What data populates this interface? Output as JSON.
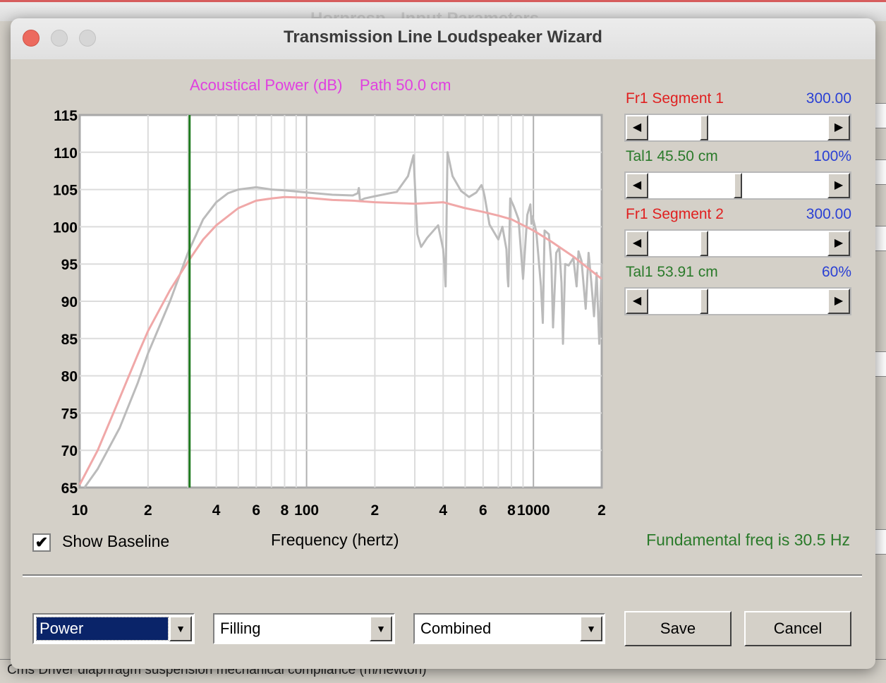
{
  "parent": {
    "title": "Hornresp - Input Parameters",
    "status": "Cms   Driver diaphragm suspension mechanical compliance  (m/newton)"
  },
  "dialog": {
    "title": "Transmission Line Loudspeaker Wizard"
  },
  "chart_header": "Acoustical Power (dB)    Path 50.0 cm",
  "params": [
    {
      "label": "Fr1  Segment 1",
      "value": "300.00",
      "label_color": "#e02020",
      "slider": 0.3
    },
    {
      "label": "Tal1  45.50 cm",
      "value": "100%",
      "label_color": "#2a7a2a",
      "slider": 0.5
    },
    {
      "label": "Fr1  Segment 2",
      "value": "300.00",
      "label_color": "#e02020",
      "slider": 0.3
    },
    {
      "label": "Tal1  53.91 cm",
      "value": "60%",
      "label_color": "#2a7a2a",
      "slider": 0.3
    }
  ],
  "show_baseline": {
    "label": "Show Baseline",
    "checked": true,
    "check_glyph": "✔"
  },
  "fundamental": "Fundamental freq is 30.5 Hz",
  "dropdowns": [
    {
      "value": "Power",
      "selected": true
    },
    {
      "value": "Filling",
      "selected": false
    },
    {
      "value": "Combined",
      "selected": false
    }
  ],
  "buttons": {
    "save": "Save",
    "cancel": "Cancel"
  },
  "chart_data": {
    "type": "line",
    "title": "Acoustical Power (dB)    Path 50.0 cm",
    "xlabel": "Frequency (hertz)",
    "ylabel": "",
    "x_scale": "log",
    "xlim": [
      10,
      2000
    ],
    "ylim": [
      65,
      115
    ],
    "y_ticks": [
      115,
      110,
      105,
      100,
      95,
      90,
      85,
      80,
      75,
      70,
      65
    ],
    "x_tick_labels": [
      {
        "x": 10,
        "label": "10"
      },
      {
        "x": 20,
        "label": "2"
      },
      {
        "x": 40,
        "label": "4"
      },
      {
        "x": 60,
        "label": "6"
      },
      {
        "x": 80,
        "label": "8"
      },
      {
        "x": 100,
        "label": "100"
      },
      {
        "x": 200,
        "label": "2"
      },
      {
        "x": 400,
        "label": "4"
      },
      {
        "x": 600,
        "label": "6"
      },
      {
        "x": 800,
        "label": "8"
      },
      {
        "x": 1000,
        "label": "1000"
      },
      {
        "x": 2000,
        "label": "2"
      }
    ],
    "grid": true,
    "marker": {
      "x": 30.5,
      "color": "#1e7a1e"
    },
    "series": [
      {
        "color": "#bbbbbb",
        "x": [
          10.5,
          12,
          15,
          18,
          20,
          25,
          30,
          35,
          40,
          45,
          50,
          60,
          70,
          80,
          100,
          130,
          160,
          168,
          170,
          172,
          180,
          200,
          250,
          280,
          296,
          302,
          308,
          320,
          340,
          380,
          400,
          405,
          410,
          418,
          440,
          480,
          520,
          560,
          590,
          600,
          610,
          640,
          700,
          730,
          760,
          770,
          775,
          790,
          820,
          860,
          900,
          940,
          970,
          980,
          990,
          1030,
          1080,
          1100,
          1120,
          1170,
          1200,
          1220,
          1260,
          1300,
          1330,
          1350,
          1380,
          1430,
          1500,
          1550,
          1580,
          1630,
          1700,
          1750,
          1800,
          1850,
          1900,
          1950,
          2000
        ],
        "y": [
          65,
          67.5,
          73,
          79,
          83,
          90,
          96.5,
          101,
          103.3,
          104.5,
          105,
          105.3,
          105,
          104.9,
          104.6,
          104.3,
          104.2,
          104.5,
          105.2,
          103.5,
          103.8,
          104.1,
          104.7,
          106.8,
          109.6,
          104,
          99,
          97.3,
          98.5,
          100.2,
          97,
          95,
          92,
          110,
          106.8,
          104.8,
          104,
          104.6,
          105.6,
          105,
          104,
          100.3,
          98.3,
          100,
          97,
          93,
          92,
          103.8,
          102.7,
          101,
          93,
          101.6,
          103,
          100.4,
          101.4,
          99.3,
          92,
          87.1,
          99.5,
          99,
          95,
          86.5,
          96.5,
          97.2,
          92.5,
          84.3,
          95,
          94.8,
          95.8,
          92,
          96.7,
          95.4,
          89,
          96.5,
          92.5,
          88,
          93.8,
          84.3,
          95
        ]
      },
      {
        "color": "#f0a8a8",
        "x": [
          10,
          12,
          15,
          18,
          20,
          25,
          30,
          35,
          40,
          50,
          60,
          70,
          80,
          100,
          130,
          160,
          200,
          300,
          400,
          500,
          600,
          700,
          800,
          1000,
          1200,
          1500,
          2000
        ],
        "y": [
          65.4,
          70,
          77,
          82.8,
          86,
          91.5,
          95.3,
          98.3,
          100.2,
          102.5,
          103.5,
          103.8,
          104,
          103.9,
          103.6,
          103.5,
          103.3,
          103.1,
          103.3,
          102.5,
          102,
          101.5,
          101,
          99.5,
          98,
          96,
          93
        ]
      }
    ]
  }
}
